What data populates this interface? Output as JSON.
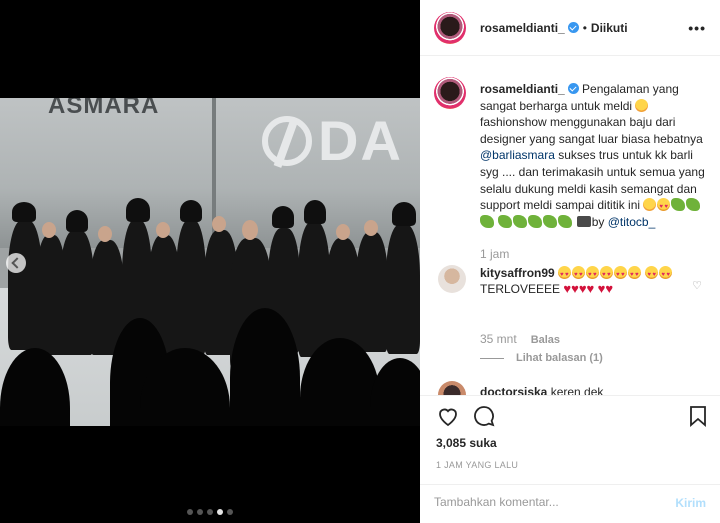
{
  "post": {
    "username": "rosameldianti_",
    "follow_separator": "•",
    "follow_status": "Diikuti",
    "more_glyph": "•••",
    "photo_brand_left": "ASMARA",
    "photo_brand_right": "DA",
    "carousel_dot_count": 5,
    "carousel_active_index": 3
  },
  "caption": {
    "username": "rosameldianti_",
    "text_1": "Pengalaman yang sangat berharga untuk meldi",
    "text_2": "fashionshow menggunakan baju dari designer yang sangat luar biasa hebatnya",
    "mention_1": "@barliasmara",
    "text_3": "sukses trus untuk kk barli syg .... dan terimakasih untuk semua yang selalu dukung meldi kasih semangat dan support meldi sampai dititik ini",
    "by_text": "by",
    "mention_2": "@titocb_",
    "time": "1 jam"
  },
  "comment": {
    "username": "kitysaffron99",
    "text": "TERLOVEEEE",
    "time": "35 mnt",
    "reply_label": "Balas",
    "view_replies": "Lihat balasan (1)"
  },
  "comment2": {
    "username": "doctorsiska",
    "text": "keren dek"
  },
  "actions": {
    "likes": "3,085 suka",
    "post_time": "1 JAM YANG LALU"
  },
  "composer": {
    "placeholder": "Tambahkan komentar...",
    "send_label": "Kirim"
  },
  "colors": {
    "link": "#003569",
    "verified": "#3897f0",
    "muted": "#999999",
    "send_disabled": "#b2dffc"
  }
}
